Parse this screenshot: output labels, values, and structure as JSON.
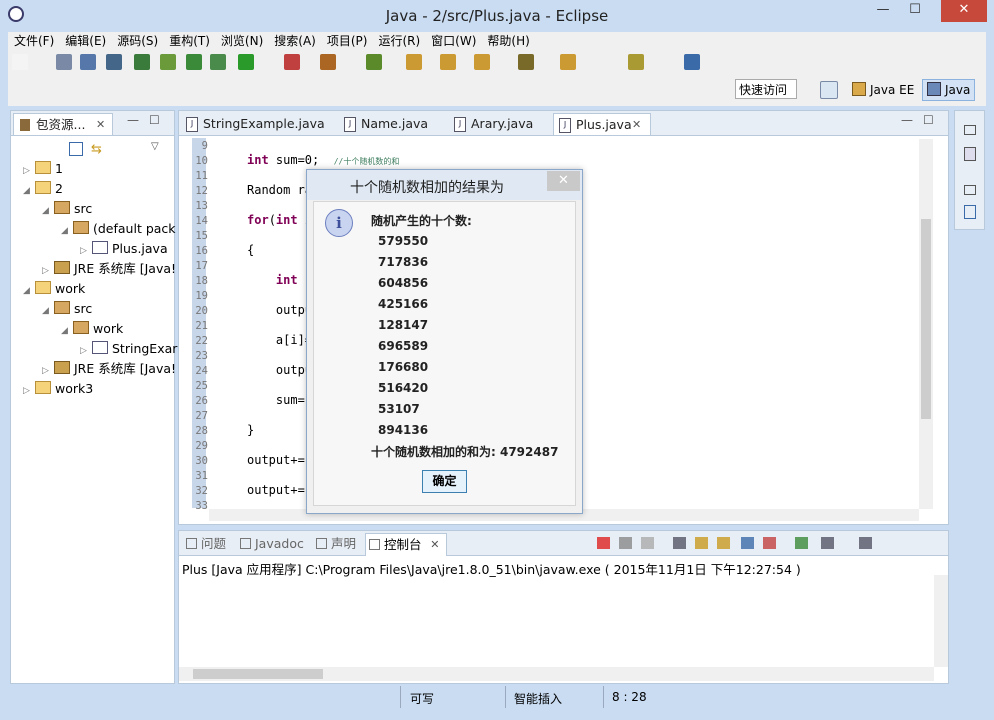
{
  "window": {
    "title": "Java  -  2/src/Plus.java  -  Eclipse",
    "min": "—",
    "max": "☐",
    "close": "✕"
  },
  "menu": [
    "文件(F)",
    "编辑(E)",
    "源码(S)",
    "重构(T)",
    "浏览(N)",
    "搜索(A)",
    "项目(P)",
    "运行(R)",
    "窗口(W)",
    "帮助(H)"
  ],
  "toolbar": {
    "quick_access": "快速访问",
    "perspective_javaee": "Java EE",
    "perspective_java": "Java"
  },
  "explorer": {
    "tab": "包资源...",
    "tree": [
      {
        "label": "1",
        "depth": 0,
        "icon": "fold",
        "tri": "▷"
      },
      {
        "label": "2",
        "depth": 0,
        "icon": "fold",
        "tri": "◢"
      },
      {
        "label": "src",
        "depth": 1,
        "icon": "pkg",
        "tri": "◢"
      },
      {
        "label": "(default pack",
        "depth": 2,
        "icon": "pkg",
        "tri": "◢"
      },
      {
        "label": "Plus.java",
        "depth": 3,
        "icon": "jfile",
        "tri": "▷"
      },
      {
        "label": "JRE 系统库 [Java!",
        "depth": 1,
        "icon": "jre",
        "tri": "▷"
      },
      {
        "label": "work",
        "depth": 0,
        "icon": "fold",
        "tri": "◢"
      },
      {
        "label": "src",
        "depth": 1,
        "icon": "pkg",
        "tri": "◢"
      },
      {
        "label": "work",
        "depth": 2,
        "icon": "pkg",
        "tri": "◢"
      },
      {
        "label": "StringExar",
        "depth": 3,
        "icon": "jfile",
        "tri": "▷"
      },
      {
        "label": "JRE 系统库 [Java!",
        "depth": 1,
        "icon": "jre",
        "tri": "▷"
      },
      {
        "label": "work3",
        "depth": 0,
        "icon": "fold",
        "tri": "▷"
      }
    ]
  },
  "editor": {
    "tabs": [
      "StringExample.java",
      "Name.java",
      "Arary.java",
      "Plus.java"
    ],
    "active_tab": 3,
    "line_numbers": [
      "9",
      "10",
      "11",
      "12",
      "13",
      "14",
      "15",
      "16",
      "17",
      "18",
      "19",
      "20",
      "21",
      "22",
      "23",
      "24",
      "25",
      "26",
      "27",
      "28",
      "29",
      "30",
      "31",
      "32",
      "33"
    ],
    "code_lines": [
      {
        "line": "10",
        "html": "<span class='kw'>int</span> sum=0;  <span class='cm'>//十个随机数的和</span>"
      },
      {
        "line": "12",
        "html": "Random ra"
      },
      {
        "line": "14",
        "html": "<span class='kw'>for</span>(<span class='kw'>int</span> i"
      },
      {
        "line": "16",
        "html": "{"
      },
      {
        "line": "18",
        "html": "    <span class='kw'>int</span> r"
      },
      {
        "line": "20",
        "html": "    outpu"
      },
      {
        "line": "22",
        "html": "    a[i]="
      },
      {
        "line": "24",
        "html": "    outpu"
      },
      {
        "line": "26",
        "html": "    sum=s"
      },
      {
        "line": "28",
        "html": "}"
      },
      {
        "line": "30",
        "html": "output+="
      },
      {
        "line": "32",
        "html": "output+=s"
      }
    ]
  },
  "dialog": {
    "title": "十个随机数相加的结果为",
    "close": "✕",
    "icon": "i",
    "heading": "随机产生的十个数:",
    "numbers": [
      "579550",
      "717836",
      "604856",
      "425166",
      "128147",
      "696589",
      "176680",
      "516420",
      "53107",
      "894136"
    ],
    "sum_line": "十个随机数相加的和为: 4792487",
    "ok": "确定"
  },
  "console": {
    "tabs": [
      "问题",
      "Javadoc",
      "声明",
      "控制台"
    ],
    "active_tab": 3,
    "run_info": "Plus [Java 应用程序] C:\\Program Files\\Java\\jre1.8.0_51\\bin\\javaw.exe ( 2015年11月1日 下午12:27:54 )"
  },
  "status": {
    "writable": "可写",
    "insert_mode": "智能插入",
    "position": "8 : 28"
  }
}
